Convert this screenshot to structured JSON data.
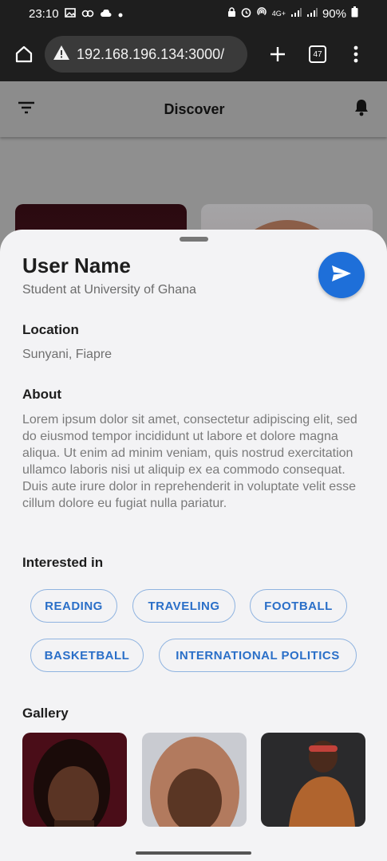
{
  "status_bar": {
    "time": "23:10",
    "battery": "90%",
    "network": "4G+"
  },
  "browser": {
    "url": "192.168.196.134:3000/",
    "tabs_count": "47"
  },
  "app_header": {
    "title": "Discover"
  },
  "profile": {
    "name": "User Name",
    "subtitle": "Student at University of Ghana",
    "location_title": "Location",
    "location": "Sunyani, Fiapre",
    "about_title": "About",
    "about": "Lorem ipsum dolor sit amet, consectetur adipiscing elit, sed do eiusmod tempor incididunt ut labore et dolore magna aliqua. Ut enim ad minim veniam, quis nostrud exercitation ullamco laboris nisi ut aliquip ex ea commodo consequat. Duis aute irure dolor in reprehenderit in voluptate velit esse cillum dolore eu fugiat nulla pariatur.",
    "interests_title": "Interested in",
    "interests": [
      "READING",
      "TRAVELING",
      "FOOTBALL",
      "BASKETBALL",
      "INTERNATIONAL POLITICS"
    ],
    "gallery_title": "Gallery"
  },
  "colors": {
    "accent": "#1e6fd9",
    "chip_text": "#2a6fc8",
    "sheet_bg": "#f3f3f5"
  }
}
